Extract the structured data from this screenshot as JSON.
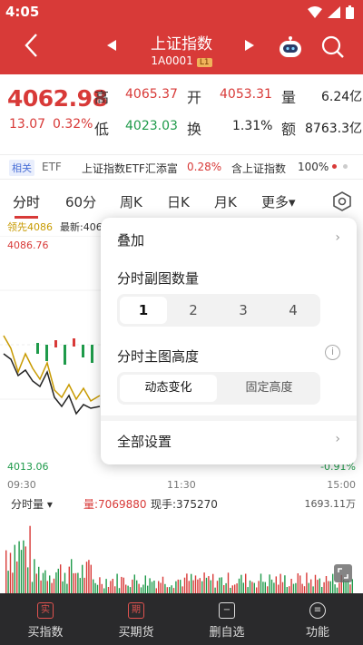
{
  "status": {
    "time": "4:05"
  },
  "header": {
    "title": "上证指数",
    "code": "1A0001",
    "level_badge": "L1"
  },
  "quote": {
    "price": "4062.98",
    "change": "13.07",
    "change_pct": "0.32%",
    "high_label": "高",
    "high_value": "4065.37",
    "low_label": "低",
    "low_value": "4023.03",
    "open_label": "开",
    "open_value": "4053.31",
    "turnover_label": "换",
    "turnover_value": "1.31%",
    "volume_label": "量",
    "volume_value": "6.24亿",
    "amount_label": "额",
    "amount_value": "8763.3亿"
  },
  "etf": {
    "tag": "相关",
    "word": "ETF",
    "name": "上证指数ETF汇添富",
    "pct": "0.28%",
    "name2": "含上证指数",
    "pct2": "100%"
  },
  "tabs": {
    "items": [
      "分时",
      "60分",
      "周K",
      "日K",
      "月K",
      "更多▾"
    ]
  },
  "chart": {
    "lead": "领先4086",
    "latest": "最新:406",
    "y_high": "4086.76",
    "y_low": "4013.06",
    "y_low_pct": "-0.91%",
    "time_start": "09:30",
    "time_mid": "11:30",
    "time_end": "15:00",
    "vol_selector": "分时量 ▾",
    "vol_text": "量:7069880",
    "vol_now": "现手:375270",
    "vol_max": "1693.11万"
  },
  "popup": {
    "overlay_label": "叠加",
    "sub_count_label": "分时副图数量",
    "sub_count_options": [
      "1",
      "2",
      "3",
      "4"
    ],
    "sub_count_selected": "1",
    "main_height_label": "分时主图高度",
    "main_height_options": [
      "动态变化",
      "固定高度"
    ],
    "main_height_selected": "动态变化",
    "all_settings_label": "全部设置"
  },
  "bottom": {
    "buy": "买指数",
    "buy_icon": "实",
    "futures": "买期货",
    "futures_icon": "期",
    "remove": "删自选",
    "remove_icon": "−",
    "func": "功能",
    "func_icon": "≡"
  },
  "colors": {
    "header_red": "#d83a38",
    "up_red": "#d83a38",
    "down_green": "#1e9a4a",
    "bottom_bar": "#2a2a2c"
  }
}
